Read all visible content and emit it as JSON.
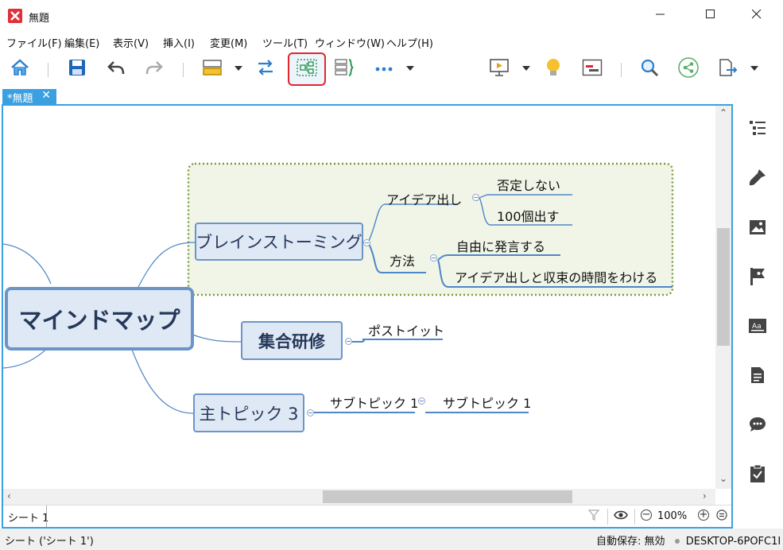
{
  "window": {
    "title": "無題",
    "minimize_icon": "minimize-icon",
    "maximize_icon": "maximize-icon",
    "close_icon": "close-icon"
  },
  "menu": [
    "ファイル(F)",
    "編集(E)",
    "表示(V)",
    "挿入(I)",
    "変更(M)",
    "ツール(T)",
    "ウィンドウ(W)",
    "ヘルプ(H)"
  ],
  "toolbar": {
    "icons": [
      "home-icon",
      "save-icon",
      "undo-icon",
      "redo-icon",
      "structure-icon",
      "relationship-icon",
      "boundary-icon",
      "summary-icon",
      "more-icon",
      "presentation-icon",
      "brainstorm-icon",
      "gantt-icon",
      "search-icon",
      "share-icon",
      "export-icon"
    ],
    "highlighted": "boundary-icon",
    "highlight_color": "#e0262e"
  },
  "tab": {
    "label": "*無題",
    "close_glyph": "✕"
  },
  "mindmap": {
    "central": "マインドマップ",
    "topics": [
      {
        "label": "ブレインストーミング"
      },
      {
        "label": "集合研修"
      },
      {
        "label": "主トピック 3"
      }
    ],
    "subtopics": {
      "idea": "アイデア出し",
      "method": "方法",
      "no_deny": "否定しない",
      "hundred": "100個出す",
      "free_speak": "自由に発言する",
      "split_time": "アイデア出しと収束の時間をわける",
      "postit": "ポストイット",
      "sub1": "サブトピック 1",
      "sub1b": "サブトピック 1"
    },
    "boundary_color": "#7a9a3a",
    "boundary_fill": "#f1f5e7",
    "topic_fill": "#dfe8f5",
    "topic_border": "#6b95c9",
    "line_color": "#4f86c6"
  },
  "sheetbar": {
    "sheet": "シート 1",
    "zoom": "100%",
    "minus": "−",
    "plus": "+"
  },
  "status": {
    "left": "シート ('シート 1')",
    "autosave": "自動保存: 無効",
    "machine": "DESKTOP-6POFC1I"
  },
  "rightpanel": {
    "icons": [
      "outline-icon",
      "format-icon",
      "image-icon",
      "marker-icon",
      "text-style-icon",
      "notes-icon",
      "comment-icon",
      "task-icon"
    ]
  },
  "colors": {
    "accent": "#3ba0e0"
  }
}
